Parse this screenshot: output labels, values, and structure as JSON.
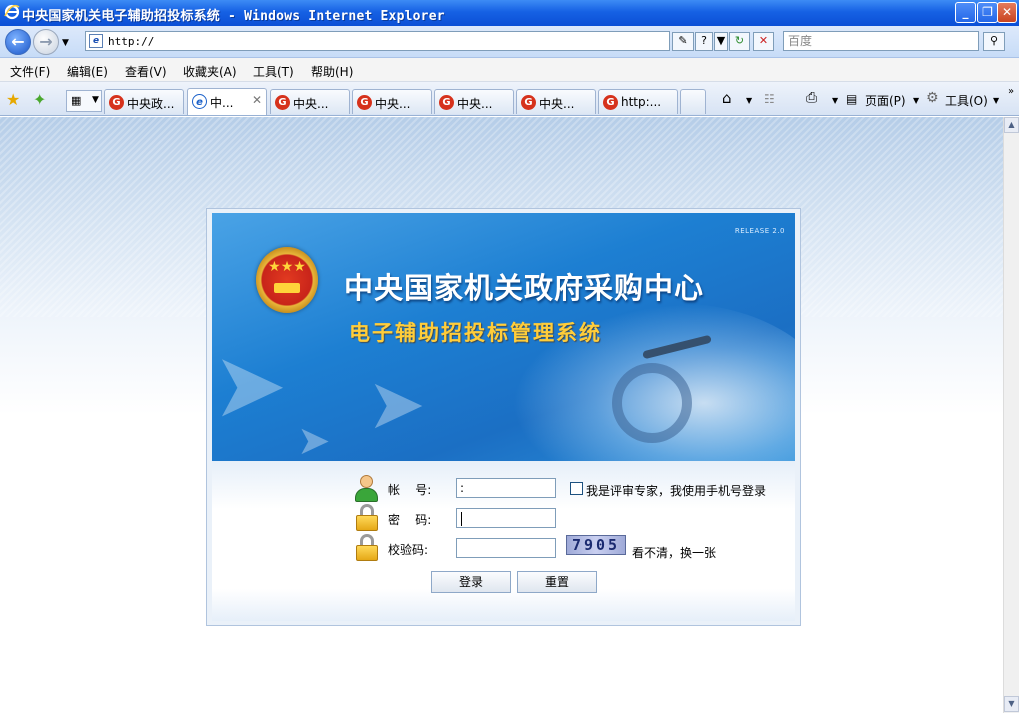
{
  "window": {
    "title": "中央国家机关电子辅助招投标系统 - Windows Internet Explorer",
    "minimize_glyph": "_",
    "restore_glyph": "❐",
    "close_glyph": "✕"
  },
  "address": {
    "url": "http://",
    "search_placeholder": "百度"
  },
  "menu": {
    "items": [
      "文件(F)",
      "编辑(E)",
      "查看(V)",
      "收藏夹(A)",
      "工具(T)",
      "帮助(H)"
    ]
  },
  "tabs": [
    {
      "label": "中央政...",
      "icon": "red-g-icon",
      "active": false
    },
    {
      "label": "中...",
      "icon": "ie-page-icon",
      "active": true
    },
    {
      "label": "中央...",
      "icon": "red-g-icon",
      "active": false
    },
    {
      "label": "中央...",
      "icon": "red-g-icon",
      "active": false
    },
    {
      "label": "中央...",
      "icon": "red-g-icon",
      "active": false
    },
    {
      "label": "中央...",
      "icon": "red-g-icon",
      "active": false
    },
    {
      "label": "http:...",
      "icon": "red-g-icon",
      "active": false
    }
  ],
  "commandbar": {
    "page": "页面(P)",
    "tools": "工具(O)"
  },
  "banner": {
    "release": "RELEASE 2.0",
    "org_name": "中央国家机关政府采购中心",
    "system_name": "电子辅助招投标管理系统"
  },
  "login": {
    "account_label": "帐    号:",
    "account_value": ":",
    "password_label": "密    码:",
    "captcha_label": "校验码:",
    "expert_checkbox_label": "我是评审专家，我使用手机号登录",
    "captcha_text": "7905",
    "refresh_captcha": "看不清，换一张",
    "login_button": "登录",
    "reset_button": "重置"
  }
}
